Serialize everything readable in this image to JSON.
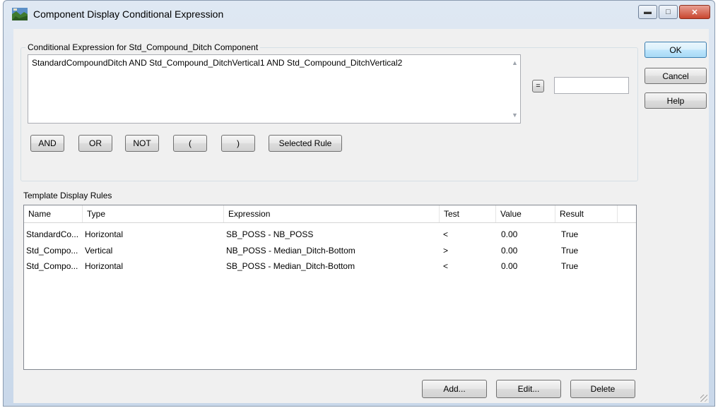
{
  "window": {
    "title": "Component Display Conditional Expression"
  },
  "conditional": {
    "group_label": "Conditional Expression for Std_Compound_Ditch Component",
    "expression": "StandardCompoundDitch AND Std_Compound_DitchVertical1 AND Std_Compound_DitchVertical2",
    "equals_label": "=",
    "buttons": {
      "and": "AND",
      "or": "OR",
      "not": "NOT",
      "open_paren": "(",
      "close_paren": ")",
      "selected_rule": "Selected Rule"
    }
  },
  "dialog_buttons": {
    "ok": "OK",
    "cancel": "Cancel",
    "help": "Help"
  },
  "rules": {
    "label": "Template Display Rules",
    "columns": [
      "Name",
      "Type",
      "Expression",
      "Test",
      "Value",
      "Result"
    ],
    "rows": [
      [
        "StandardCo...",
        "Horizontal",
        "SB_POSS - NB_POSS",
        "<",
        "0.00",
        "True"
      ],
      [
        "Std_Compo...",
        "Vertical",
        "NB_POSS - Median_Ditch-Bottom",
        ">",
        "0.00",
        "True"
      ],
      [
        "Std_Compo...",
        "Horizontal",
        "SB_POSS - Median_Ditch-Bottom",
        "<",
        "0.00",
        "True"
      ]
    ]
  },
  "list_buttons": {
    "add": "Add...",
    "edit": "Edit...",
    "delete": "Delete"
  }
}
